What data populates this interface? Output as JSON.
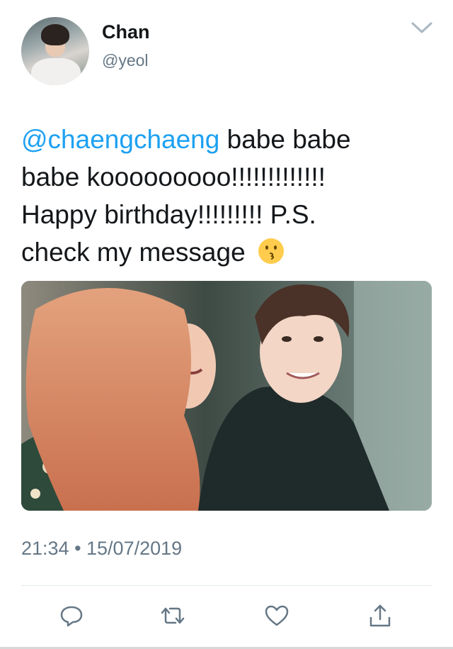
{
  "tweet": {
    "author_name": "Chan",
    "author_handle": "@yeol",
    "text_lines": [
      {
        "mention": "@chaengchaeng",
        "rest": " babe babe"
      },
      {
        "text": "babe kooooooooo!!!!!!!!!!!!!"
      },
      {
        "text": "Happy birthday!!!!!!!!! P.S."
      },
      {
        "text": "check my message "
      }
    ],
    "emoji_name": "kissing-face-icon",
    "timestamp": "21:34 • 15/07/2019"
  },
  "actions": {
    "reply_icon": "reply-icon",
    "retweet_icon": "retweet-icon",
    "like_icon": "heart-icon",
    "share_icon": "share-icon"
  },
  "colors": {
    "mention": "#1da1f2",
    "secondary_text": "#657786",
    "primary_text": "#14171a",
    "icon": "#657786",
    "divider": "#e1e8ed"
  }
}
